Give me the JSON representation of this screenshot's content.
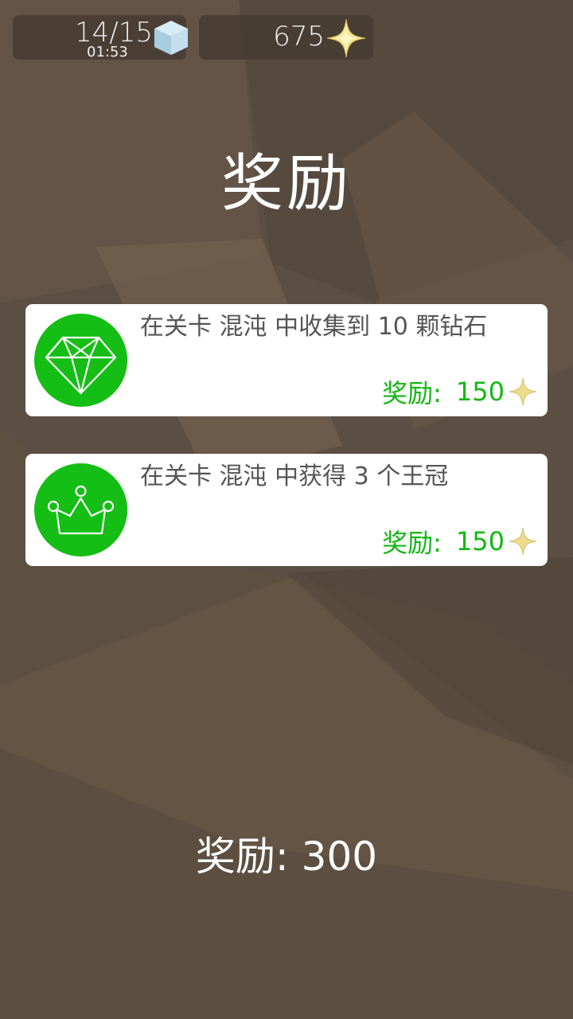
{
  "hud": {
    "level_progress": "14/15",
    "timer": "01:53",
    "cube_icon": "ice-cube-icon",
    "coins": "675",
    "coin_icon": "sparkle-star-icon"
  },
  "title": "奖励",
  "tasks": [
    {
      "icon": "diamond-icon",
      "description": "在关卡 混沌 中收集到 10 颗钻石",
      "reward_label": "奖励:",
      "reward_value": "150"
    },
    {
      "icon": "crown-icon",
      "description": "在关卡 混沌 中获得 3 个王冠",
      "reward_label": "奖励:",
      "reward_value": "150"
    }
  ],
  "total_reward": "奖励: 300",
  "colors": {
    "badge_green": "#14be14",
    "reward_green": "#12b812",
    "background": "#5b4f43"
  }
}
